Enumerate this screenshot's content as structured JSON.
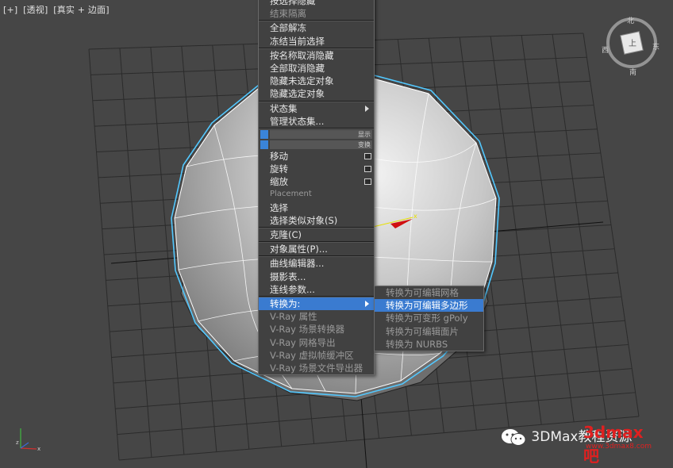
{
  "viewport": {
    "labels": [
      "[+]",
      "[透视]",
      "[真实 + 边面]"
    ],
    "viewcube": {
      "north": "北",
      "south": "南",
      "east": "东",
      "west": "西"
    }
  },
  "context_menu": {
    "top_partial": [
      "按选择隐藏",
      "结束隔离"
    ],
    "items_a": [
      "全部解冻",
      "冻结当前选择"
    ],
    "items_b": [
      "按名称取消隐藏",
      "全部取消隐藏",
      "隐藏未选定对象",
      "隐藏选定对象"
    ],
    "state_sets": "状态集",
    "manage_state_sets": "管理状态集...",
    "display_label": "显示",
    "transform_label": "变换",
    "move": "移动",
    "rotate": "旋转",
    "scale": "缩放",
    "placement": "Placement",
    "select": "选择",
    "select_similar": "选择类似对象(S)",
    "clone": "克隆(C)",
    "object_properties": "对象属性(P)...",
    "curve_editor": "曲线编辑器...",
    "dope_sheet": "摄影表...",
    "wire_parameters": "连线参数...",
    "convert_to": "转换为:",
    "vray_items": [
      "V-Ray 属性",
      "V-Ray 场景转换器",
      "V-Ray 网格导出",
      "V-Ray 虚拟帧缓冲区",
      "V-Ray 场景文件导出器"
    ]
  },
  "submenu": {
    "items": [
      "转换为可编辑网格",
      "转换为可编辑多边形",
      "转换为可变形 gPoly",
      "转换为可编辑面片",
      "转换为 NURBS"
    ],
    "highlighted_index": 1
  },
  "watermark": {
    "text": "3DMax教程资源",
    "overlay": "3dmax吧",
    "url": "www.3dmax8.com"
  },
  "colors": {
    "menu_bg": "#414141",
    "highlight": "#3a7bd0",
    "selection_outline": "#4fc6ff",
    "grid": "#2a2a2a"
  }
}
